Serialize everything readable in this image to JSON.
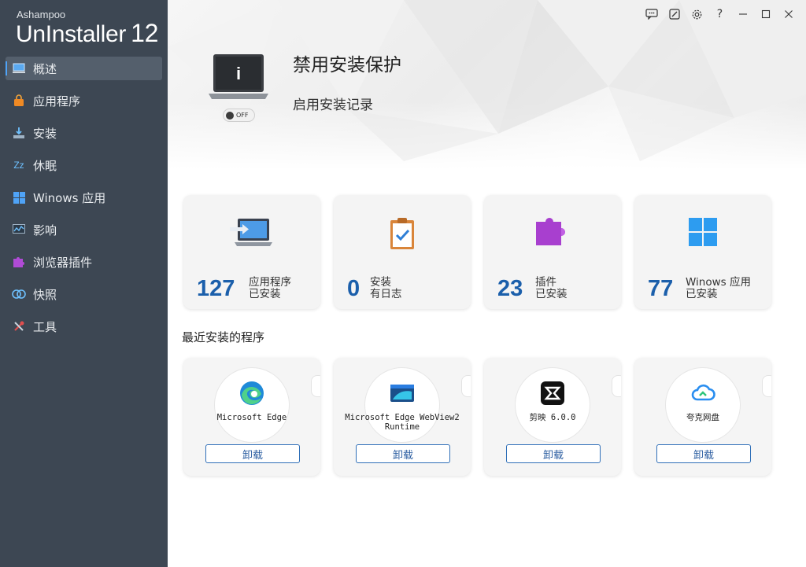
{
  "brand": {
    "small": "Ashampoo",
    "name": "UnInstaller",
    "version": "12"
  },
  "sidebar": {
    "items": [
      {
        "label": "概述",
        "icon": "overview-icon",
        "active": true
      },
      {
        "label": "应用程序",
        "icon": "applications-icon"
      },
      {
        "label": "安装",
        "icon": "install-icon"
      },
      {
        "label": "休眠",
        "icon": "hibernate-icon"
      },
      {
        "label": "Winows 应用",
        "icon": "windows-apps-icon"
      },
      {
        "label": "影响",
        "icon": "impact-icon"
      },
      {
        "label": "浏览器插件",
        "icon": "browser-plugins-icon"
      },
      {
        "label": "快照",
        "icon": "snapshot-icon"
      },
      {
        "label": "工具",
        "icon": "tools-icon"
      }
    ]
  },
  "titlebar": {
    "buttons": [
      "feedback-icon",
      "edit-icon",
      "settings-icon",
      "help-icon",
      "minimize-icon",
      "maximize-icon",
      "close-icon"
    ],
    "help_glyph": "?"
  },
  "hero": {
    "title": "禁用安装保护",
    "subtitle": "启用安装记录",
    "toggle_label": "OFF",
    "laptop_glyph": "i"
  },
  "stats": [
    {
      "value": "127",
      "line1": "应用程序",
      "line2": "已安装",
      "icon": "laptop-import-icon"
    },
    {
      "value": "0",
      "line1": "安装",
      "line2": "有日志",
      "icon": "clipboard-check-icon"
    },
    {
      "value": "23",
      "line1": "插件",
      "line2": "已安装",
      "icon": "puzzle-icon"
    },
    {
      "value": "77",
      "line1": "Winows 应用",
      "line2": "已安装",
      "icon": "windows-logo-icon"
    }
  ],
  "recent": {
    "title": "最近安装的程序",
    "apps": [
      {
        "name": "Microsoft Edge",
        "icon": "edge-icon",
        "button": "卸载"
      },
      {
        "name": "Microsoft Edge WebView2 Runtime",
        "icon": "webview2-icon",
        "button": "卸载"
      },
      {
        "name": "剪映 6.0.0",
        "icon": "capcut-icon",
        "button": "卸载"
      },
      {
        "name": "夸克网盘",
        "icon": "quark-cloud-icon",
        "button": "卸载"
      }
    ]
  },
  "colors": {
    "sidebar": "#3d4753",
    "accent": "#1b5fab",
    "button_border": "#2f6fb8"
  }
}
